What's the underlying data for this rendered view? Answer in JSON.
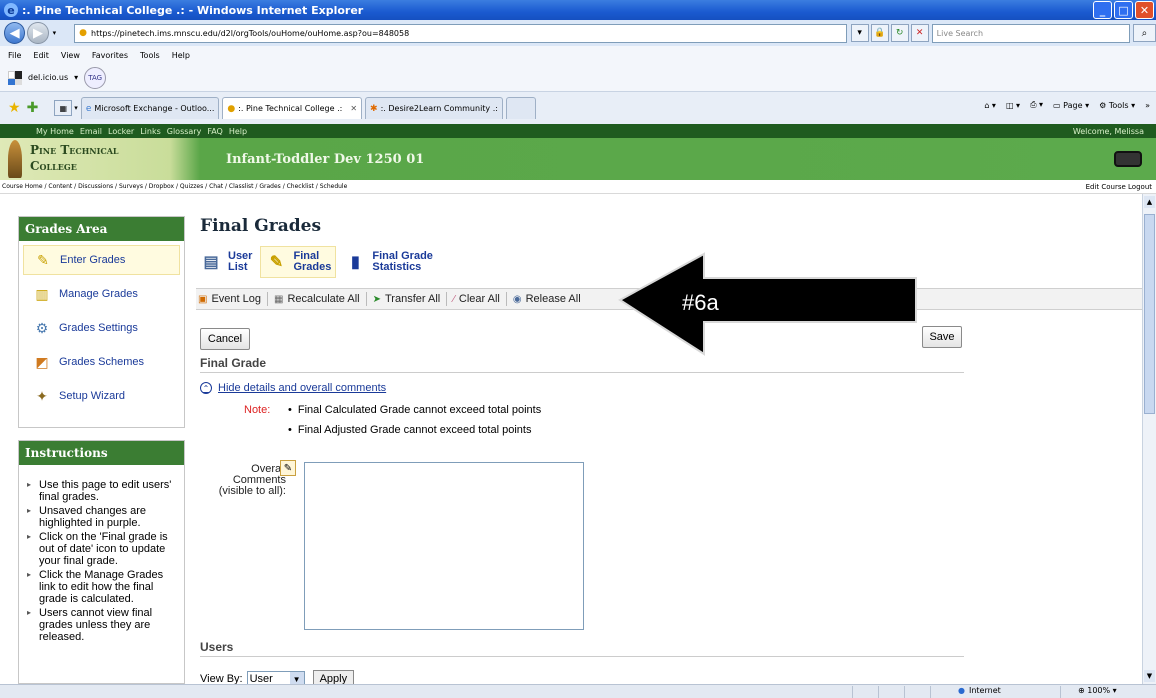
{
  "window": {
    "title": ":. Pine Technical College .: - Windows Internet Explorer"
  },
  "browser": {
    "url": "https://pinetech.ims.mnscu.edu/d2l/orgTools/ouHome/ouHome.asp?ou=848058",
    "search_placeholder": "Live Search",
    "menu": [
      "File",
      "Edit",
      "View",
      "Favorites",
      "Tools",
      "Help"
    ],
    "links": {
      "delicious": "del.icio.us",
      "tag": "TAG"
    },
    "tabs": [
      {
        "label": "Microsoft Exchange - Outloo..."
      },
      {
        "label": ":. Pine Technical College .:"
      },
      {
        "label": ":. Desire2Learn Community .:"
      }
    ],
    "right_tools": {
      "page": "Page",
      "tools": "Tools"
    }
  },
  "d2l": {
    "topnav": [
      "My Home",
      "Email",
      "Locker",
      "Links",
      "Glossary",
      "FAQ",
      "Help"
    ],
    "welcome": "Welcome, Melissa",
    "logo_line1": "Pine Technical",
    "logo_line2": "College",
    "course_title": "Infant-Toddler Dev 1250 01",
    "breadcrumbs": "Course Home / Content / Discussions / Surveys / Dropbox / Quizzes / Chat / Classlist / Grades / Checklist / Schedule",
    "edit_course": "Edit Course",
    "logout": "Logout"
  },
  "sidebar": {
    "grades_area_title": "Grades Area",
    "items": [
      {
        "label": "Enter Grades",
        "icon": "enter-grades-icon"
      },
      {
        "label": "Manage Grades",
        "icon": "manage-grades-icon"
      },
      {
        "label": "Grades Settings",
        "icon": "settings-gears-icon"
      },
      {
        "label": "Grades Schemes",
        "icon": "schemes-icon"
      },
      {
        "label": "Setup Wizard",
        "icon": "wizard-wand-icon"
      }
    ],
    "instructions_title": "Instructions",
    "instructions": [
      "Use this page to edit users' final grades.",
      "Unsaved changes are highlighted in purple.",
      "Click on the 'Final grade is out of date' icon to update your final grade.",
      "Click the Manage Grades link to edit how the final grade is calculated.",
      "Users cannot view final grades unless they are released."
    ]
  },
  "main": {
    "title": "Final Grades",
    "subnav": [
      {
        "line1": "User",
        "line2": "List"
      },
      {
        "line1": "Final",
        "line2": "Grades"
      },
      {
        "line1": "Final Grade",
        "line2": "Statistics"
      }
    ],
    "toolbar": [
      "Event Log",
      "Recalculate All",
      "Transfer All",
      "Clear All",
      "Release All"
    ],
    "cancel_label": "Cancel",
    "save_label": "Save",
    "final_grade_heading": "Final Grade",
    "hide_details_link": "Hide details and overall comments",
    "note_label": "Note:",
    "notes": [
      "Final Calculated Grade cannot exceed total points",
      "Final Adjusted Grade cannot exceed total points"
    ],
    "comments_label": "Overall Comments (visible to all):",
    "comments_value": "",
    "users_heading": "Users",
    "view_by_label": "View By:",
    "view_by_value": "User",
    "apply_label": "Apply"
  },
  "callout": {
    "label": "#6a"
  },
  "status": {
    "zone": "Internet",
    "zoom": "100%"
  }
}
